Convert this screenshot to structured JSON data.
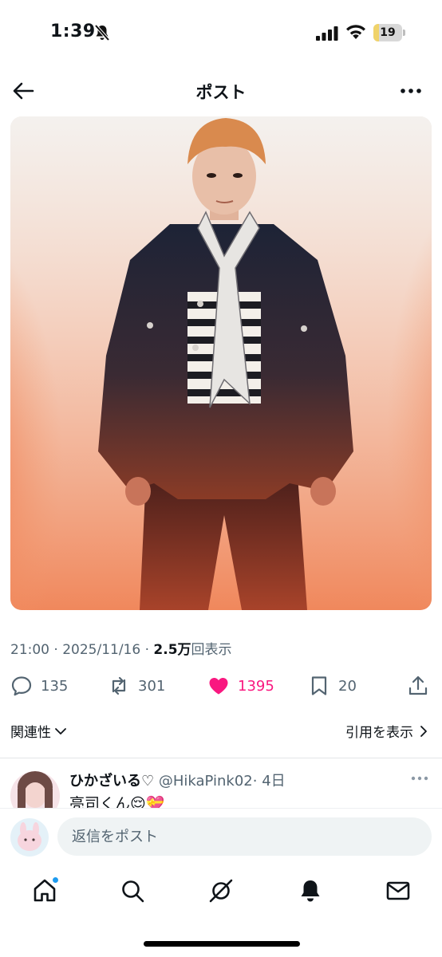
{
  "status_bar": {
    "time": "1:39",
    "battery_level": "19",
    "battery_fraction": 0.19,
    "icons": [
      "bell-slash-icon",
      "cellular-signal-icon",
      "wifi-icon",
      "battery-icon"
    ],
    "battery_color": "#f0d36a"
  },
  "header": {
    "title": "ポスト",
    "icons": [
      "arrow-left-icon",
      "ellipsis-icon"
    ]
  },
  "post": {
    "meta_prefix": "21:00 · 2025/11/16 · ",
    "views_count": "2.5万",
    "views_suffix": "回表示",
    "replies": "135",
    "reposts": "301",
    "likes": "1395",
    "bookmarks": "20",
    "liked": true,
    "action_icons": [
      "reply-icon",
      "repost-icon",
      "heart-icon",
      "bookmark-icon",
      "share-icon"
    ],
    "like_color": "#f91880"
  },
  "sort": {
    "label": "関連性",
    "quotes_label": "引用を表示"
  },
  "reply": {
    "name": "ひかざいる♡",
    "handle": "@HikaPink02",
    "time": "· 4日",
    "text": "亮司くん😌💝"
  },
  "composer": {
    "placeholder": "返信をポスト"
  },
  "tab_bar": {
    "tabs": [
      "home-icon",
      "search-icon",
      "grok-icon",
      "notifications-icon",
      "messages-icon"
    ],
    "home_has_badge": true,
    "accent_color": "#1d9bf0"
  }
}
